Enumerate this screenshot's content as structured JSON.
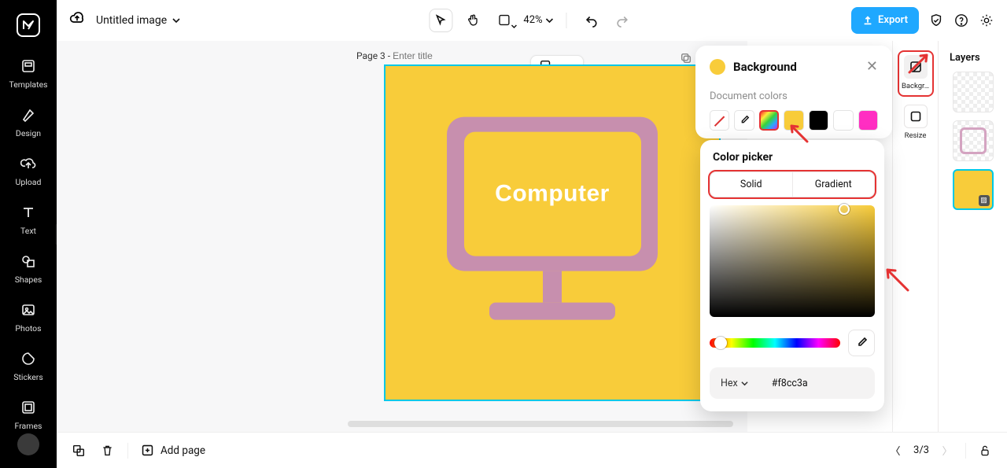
{
  "app": {
    "title": "Untitled image"
  },
  "leftRail": {
    "items": [
      {
        "label": "Templates"
      },
      {
        "label": "Design"
      },
      {
        "label": "Upload"
      },
      {
        "label": "Text"
      },
      {
        "label": "Shapes"
      },
      {
        "label": "Photos"
      },
      {
        "label": "Stickers"
      },
      {
        "label": "Frames"
      }
    ]
  },
  "topbar": {
    "zoom": "42%",
    "export": "Export"
  },
  "page": {
    "label_prefix": "Page 3 - ",
    "title_placeholder": "Enter title"
  },
  "canvas": {
    "text": "Computer",
    "bg_color": "#f8cc3a",
    "shape_color": "#c78fae"
  },
  "toolsCol": {
    "background": "Backgr…",
    "resize": "Resize"
  },
  "layers": {
    "title": "Layers"
  },
  "bgPanel": {
    "title": "Background",
    "doc_colors_label": "Document colors",
    "swatches": [
      "none",
      "eyedropper",
      "picker",
      "yellow",
      "black",
      "white",
      "magenta"
    ]
  },
  "colorPicker": {
    "title": "Color picker",
    "tab_solid": "Solid",
    "tab_gradient": "Gradient",
    "hex_label": "Hex",
    "hex_value": "#f8cc3a"
  },
  "bottombar": {
    "add_page": "Add page",
    "page_indicator": "3/3"
  }
}
